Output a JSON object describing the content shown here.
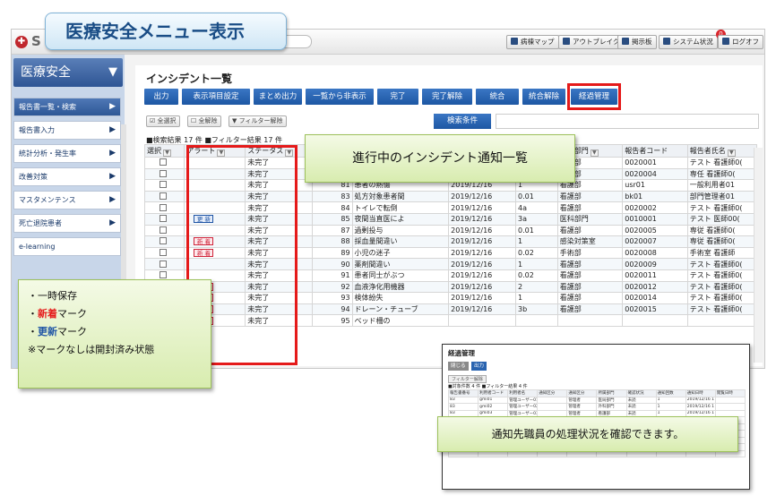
{
  "banner_title": "医療安全メニュー表示",
  "topbar": {
    "logo_letter": "S",
    "buttons": [
      "病棟マップ",
      "アウトブレイク",
      "掲示板",
      "システム状況",
      "ログオフ"
    ],
    "system_badge": "0"
  },
  "sidebar": {
    "title": "医療安全",
    "items": [
      "報告書一覧・検索",
      "報告書入力",
      "統計分析・発生率",
      "改善対策",
      "マスタメンテンス",
      "死亡退院患者",
      "e-learning"
    ]
  },
  "main": {
    "title": "インシデント一覧",
    "actions": [
      "出力",
      "表示項目設定",
      "まとめ出力",
      "一覧から非表示",
      "完了",
      "完了解除",
      "統合",
      "統合解除",
      "経過管理"
    ],
    "small_buttons": [
      "全選択",
      "全解除",
      "フィルター解除"
    ],
    "search_label": "検索条件",
    "count_text": "■検索結果 17 件 ■フィルター結果 17 件",
    "columns": [
      "選択",
      "アラート",
      "ステータス",
      "報",
      "",
      "",
      "所属部門",
      "報告者コード",
      "報告者氏名"
    ],
    "rows": [
      {
        "alert": "",
        "status": "未完了",
        "no": "",
        "title": "",
        "date": "",
        "lvl": "",
        "dept": "看護部",
        "code": "0020001",
        "name": "テスト 看護師0("
      },
      {
        "alert": "",
        "status": "未完了",
        "no": "60",
        "title": "採尿漏鉱",
        "date": "2019/12/11",
        "lvl": "0.01",
        "dept": "看護部",
        "code": "0020004",
        "name": "専任 看護師0("
      },
      {
        "alert": "",
        "status": "未完了",
        "no": "81",
        "title": "患者の熱傷",
        "date": "2019/12/16",
        "lvl": "1",
        "dept": "看護部",
        "code": "usr01",
        "name": "一般利用者01"
      },
      {
        "alert": "",
        "status": "未完了",
        "no": "83",
        "title": "処方対象患者間",
        "date": "2019/12/16",
        "lvl": "0.01",
        "dept": "看護部",
        "code": "bk01",
        "name": "部門管理者01"
      },
      {
        "alert": "",
        "status": "未完了",
        "no": "84",
        "title": "トイレで転倒",
        "date": "2019/12/16",
        "lvl": "4a",
        "dept": "看護部",
        "code": "0020002",
        "name": "テスト 看護師0("
      },
      {
        "alert": "upd",
        "status": "未完了",
        "no": "85",
        "title": "夜間当直医によ",
        "date": "2019/12/16",
        "lvl": "3a",
        "dept": "医科部門",
        "code": "0010001",
        "name": "テスト 医師00("
      },
      {
        "alert": "",
        "status": "未完了",
        "no": "87",
        "title": "過剰投与",
        "date": "2019/12/16",
        "lvl": "0.01",
        "dept": "看護部",
        "code": "0020005",
        "name": "専従 看護師0("
      },
      {
        "alert": "new",
        "status": "未完了",
        "no": "88",
        "title": "採血量間違い",
        "date": "2019/12/16",
        "lvl": "1",
        "dept": "感染対策室",
        "code": "0020007",
        "name": "専従 看護師0("
      },
      {
        "alert": "new",
        "status": "未完了",
        "no": "89",
        "title": "小児の迷子",
        "date": "2019/12/16",
        "lvl": "0.02",
        "dept": "手術部",
        "code": "0020008",
        "name": "手術室 看護師"
      },
      {
        "alert": "",
        "status": "未完了",
        "no": "90",
        "title": "薬剤間違い",
        "date": "2019/12/16",
        "lvl": "1",
        "dept": "看護部",
        "code": "0020009",
        "name": "テスト 看護師0("
      },
      {
        "alert": "",
        "status": "未完了",
        "no": "91",
        "title": "患者同士がぶつ",
        "date": "2019/12/16",
        "lvl": "0.02",
        "dept": "看護部",
        "code": "0020011",
        "name": "テスト 看護師0("
      },
      {
        "alert": "new",
        "status": "未完了",
        "no": "92",
        "title": "血液浄化用機器",
        "date": "2019/12/16",
        "lvl": "2",
        "dept": "看護部",
        "code": "0020012",
        "name": "テスト 看護師0("
      },
      {
        "alert": "new",
        "status": "未完了",
        "no": "93",
        "title": "検体紛失",
        "date": "2019/12/16",
        "lvl": "1",
        "dept": "看護部",
        "code": "0020014",
        "name": "テスト 看護師0("
      },
      {
        "alert": "new",
        "status": "未完了",
        "no": "94",
        "title": "ドレーン・チューブ",
        "date": "2019/12/16",
        "lvl": "3b",
        "dept": "看護部",
        "code": "0020015",
        "name": "テスト 看護師0("
      },
      {
        "alert": "new",
        "status": "未完了",
        "no": "95",
        "title": "ベッド柵の",
        "date": "",
        "lvl": "",
        "dept": "",
        "code": "",
        "name": ""
      }
    ],
    "badge_new": "新 着",
    "badge_upd": "更 新"
  },
  "callouts": {
    "list": "進行中のインシデント通知一覧",
    "legend": {
      "line1": "・一時保存",
      "line2_prefix": "・",
      "line2_mark": "新着",
      "line2_suffix": "マーク",
      "line3_prefix": "・",
      "line3_mark": "更新",
      "line3_suffix": "マーク",
      "line4": "※マークなしは開封済み状態"
    },
    "status": "通知先職員の処理状況を確認できます。"
  },
  "popup": {
    "title": "経過管理",
    "buttons": [
      "閉じる",
      "出力"
    ],
    "filter": "フィルター解除",
    "count": "■対象件数 4 件 ■フィルター結果 4 件",
    "columns": [
      "報告書番号",
      "利用者コード",
      "利用者名",
      "通知区分",
      "通知区分",
      "所属部門",
      "確認状況",
      "通知回数",
      "通知日時",
      "閲覧日時"
    ],
    "rows": [
      [
        "83",
        "gmi01",
        "管理ユーザー01",
        "",
        "管理者",
        "医局部門",
        "未読",
        "1",
        "2019/12/16 1",
        ""
      ],
      [
        "83",
        "gmi02",
        "管理ユーザー02",
        "",
        "管理者",
        "外科部門",
        "未読",
        "1",
        "2019/12/16 1",
        ""
      ],
      [
        "83",
        "gmi03",
        "管理ユーザー03",
        "",
        "管理者",
        "看護部",
        "未読",
        "1",
        "2019/12/16 1",
        ""
      ],
      [
        "83",
        "gmi04",
        "管理ユーザー04",
        "",
        "管理者",
        "看護部",
        "未読",
        "1",
        "2019/12/16 1",
        ""
      ]
    ]
  }
}
